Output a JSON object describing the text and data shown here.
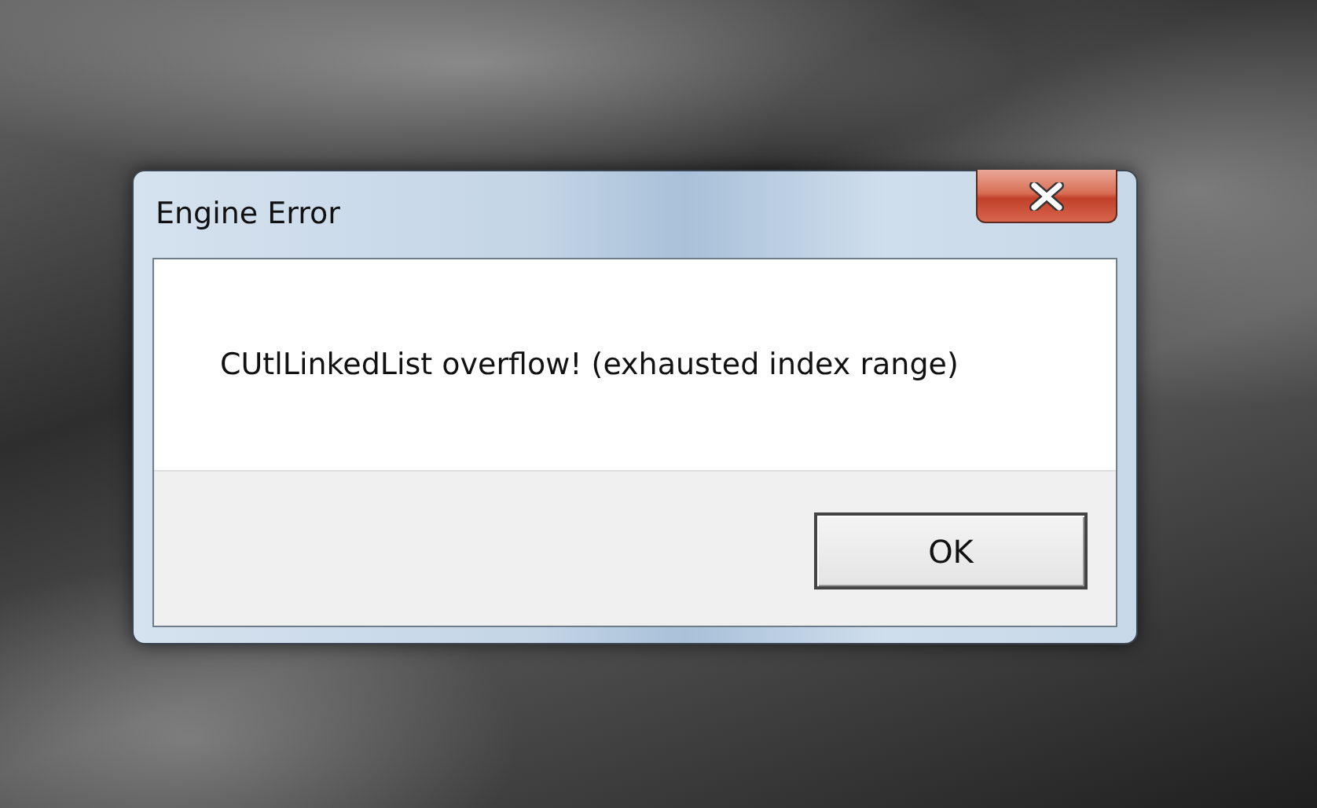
{
  "window": {
    "title": "Engine Error"
  },
  "message": "CUtlLinkedList overflow! (exhausted index range)",
  "buttons": [
    "OK"
  ]
}
